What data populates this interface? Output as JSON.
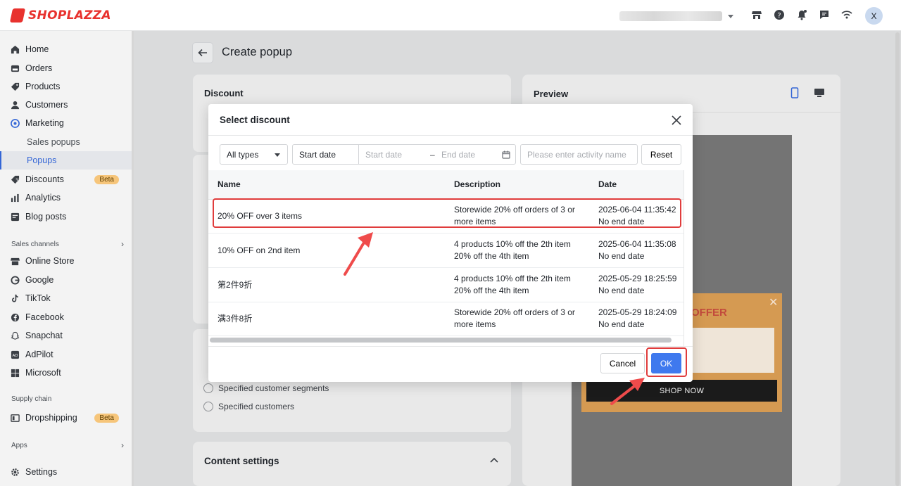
{
  "app": {
    "brand": "SHOPLAZZA",
    "avatar_initial": "X"
  },
  "topbar_icons": [
    "store-icon",
    "help-icon",
    "bell-icon",
    "chat-icon",
    "wifi-icon"
  ],
  "sidebar": {
    "items": [
      {
        "label": "Home",
        "icon": "home-icon"
      },
      {
        "label": "Orders",
        "icon": "orders-icon"
      },
      {
        "label": "Products",
        "icon": "tag-icon"
      },
      {
        "label": "Customers",
        "icon": "person-icon"
      },
      {
        "label": "Marketing",
        "icon": "marketing-icon"
      },
      {
        "label": "Sales popups",
        "icon": ""
      },
      {
        "label": "Popups",
        "icon": ""
      },
      {
        "label": "Discounts",
        "icon": "discount-icon",
        "badge": "Beta"
      },
      {
        "label": "Analytics",
        "icon": "analytics-icon"
      },
      {
        "label": "Blog posts",
        "icon": "blog-icon"
      }
    ],
    "sections": {
      "sales_channels": "Sales channels",
      "supply_chain": "Supply chain",
      "apps": "Apps"
    },
    "channels": [
      {
        "label": "Online Store",
        "icon": "store-icon"
      },
      {
        "label": "Google",
        "icon": "google-icon"
      },
      {
        "label": "TikTok",
        "icon": "tiktok-icon"
      },
      {
        "label": "Facebook",
        "icon": "facebook-icon"
      },
      {
        "label": "Snapchat",
        "icon": "snapchat-icon"
      },
      {
        "label": "AdPilot",
        "icon": "adpilot-icon"
      },
      {
        "label": "Microsoft",
        "icon": "microsoft-icon"
      }
    ],
    "supply": [
      {
        "label": "Dropshipping",
        "icon": "dropshipping-icon",
        "badge": "Beta"
      }
    ],
    "settings": "Settings"
  },
  "main": {
    "page_title": "Create popup",
    "discount_card_title": "Discount",
    "preview_title": "Preview",
    "offer_title": "OFFER",
    "shop_now": "SHOP NOW",
    "target_options": [
      "Specified customer segments",
      "Specified customers"
    ],
    "content_settings": "Content settings"
  },
  "modal": {
    "title": "Select discount",
    "type_select": "All types",
    "start_date_label": "Start date",
    "start_placeholder": "Start date",
    "date_sep": "–",
    "end_placeholder": "End date",
    "search_placeholder": "Please enter activity name",
    "reset": "Reset",
    "columns": {
      "name": "Name",
      "description": "Description",
      "date": "Date"
    },
    "rows": [
      {
        "name": "20% OFF over 3 items",
        "desc1": "Storewide 20% off orders of 3 or",
        "desc2": "more items",
        "date1": "2025-06-04 11:35:42",
        "date2": "No end date"
      },
      {
        "name": "10% OFF on 2nd item",
        "desc1": "4 products 10% off the 2th item",
        "desc2": "20% off the 4th item",
        "date1": "2025-06-04 11:35:08",
        "date2": "No end date"
      },
      {
        "name": "第2件9折",
        "desc1": "4 products 10% off the 2th item",
        "desc2": "20% off the 4th item",
        "date1": "2025-05-29 18:25:59",
        "date2": "No end date"
      },
      {
        "name": "满3件8折",
        "desc1": "Storewide 20% off orders of 3 or",
        "desc2": "more items",
        "date1": "2025-05-29 18:24:09",
        "date2": "No end date"
      }
    ],
    "cancel": "Cancel",
    "ok": "OK"
  },
  "colors": {
    "accent": "#3f79ee",
    "brand": "#e8322e",
    "highlight": "#e03c3c",
    "beta": "#f6c57a"
  }
}
